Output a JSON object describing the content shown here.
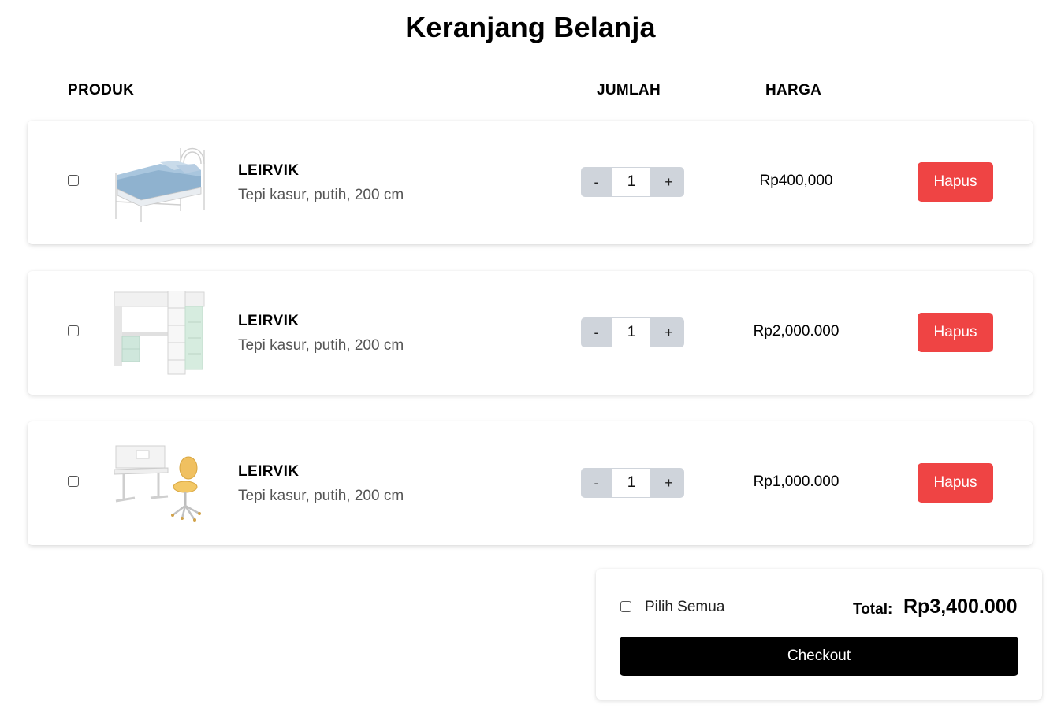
{
  "page": {
    "title": "Keranjang Belanja"
  },
  "columns": {
    "produk": "PRODUK",
    "jumlah": "JUMLAH",
    "harga": "HARGA"
  },
  "items": [
    {
      "name": "LEIRVIK",
      "description": "Tepi kasur, putih, 200 cm",
      "quantity": "1",
      "price": "Rp400,000",
      "minus_label": "-",
      "plus_label": "+",
      "delete_label": "Hapus",
      "image": "bed-frame-image"
    },
    {
      "name": "LEIRVIK",
      "description": "Tepi kasur, putih, 200 cm",
      "quantity": "1",
      "price": "Rp2,000.000",
      "minus_label": "-",
      "plus_label": "+",
      "delete_label": "Hapus",
      "image": "loft-bed-desk-image"
    },
    {
      "name": "LEIRVIK",
      "description": "Tepi kasur, putih, 200 cm",
      "quantity": "1",
      "price": "Rp1,000.000",
      "minus_label": "-",
      "plus_label": "+",
      "delete_label": "Hapus",
      "image": "desk-and-chair-image"
    }
  ],
  "summary": {
    "select_all_label": "Pilih Semua",
    "total_label": "Total:",
    "total_value": "Rp3,400.000",
    "checkout_label": "Checkout"
  },
  "colors": {
    "delete_button": "#ef4444",
    "checkout_button": "#000000",
    "stepper": "#cfd4db"
  }
}
